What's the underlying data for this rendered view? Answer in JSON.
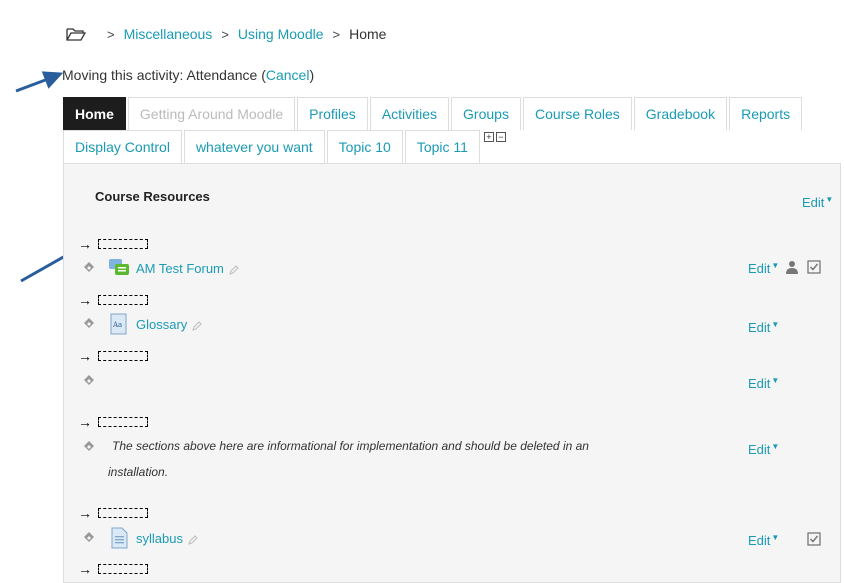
{
  "breadcrumb": {
    "items": [
      "Miscellaneous",
      "Using Moodle"
    ],
    "current": "Home",
    "separator": ">"
  },
  "moving": {
    "prefix": "Moving this activity: Attendance (",
    "cancel": "Cancel",
    "suffix": ")"
  },
  "tabs": {
    "row1": [
      "Home",
      "Getting Around Moodle",
      "Profiles",
      "Activities",
      "Groups",
      "Course Roles",
      "Gradebook",
      "Reports"
    ],
    "row2": [
      "Display Control",
      "whatever you want",
      "Topic 10",
      "Topic 11"
    ]
  },
  "section": {
    "title": "Course Resources",
    "edit": "Edit",
    "items": [
      {
        "name": "AM Test Forum",
        "icon": "forum-icon",
        "edit": "Edit"
      },
      {
        "name": "Glossary",
        "icon": "glossary-icon",
        "edit": "Edit"
      },
      {
        "name": "",
        "icon": "",
        "edit": "Edit"
      },
      {
        "name": "The sections above here are informational for implementation and should be deleted in an installation.",
        "icon": "",
        "edit": "Edit"
      },
      {
        "name": "syllabus",
        "icon": "file-icon",
        "edit": "Edit"
      }
    ]
  },
  "colors": {
    "link": "#1a9bb5",
    "active_tab": "#1d1d1d",
    "panel_bg": "#f5f5f5",
    "arrow_annotation": "#2a5d9c"
  }
}
